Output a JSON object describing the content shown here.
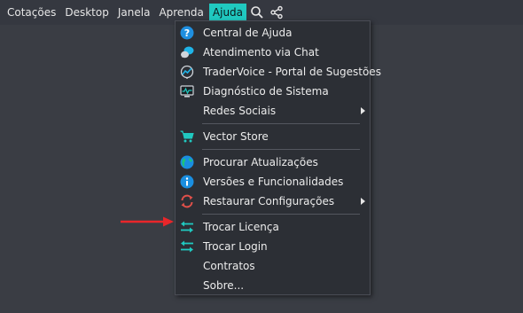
{
  "menubar": {
    "items": [
      {
        "label": "Cotações"
      },
      {
        "label": "Desktop"
      },
      {
        "label": "Janela"
      },
      {
        "label": "Aprenda"
      },
      {
        "label": "Ajuda"
      }
    ],
    "active": "Ajuda"
  },
  "help_menu": {
    "items": [
      {
        "label": "Central de Ajuda",
        "icon": "help-icon"
      },
      {
        "label": "Atendimento via Chat",
        "icon": "chat-icon"
      },
      {
        "label": "TraderVoice - Portal de Sugestões",
        "icon": "tradervoice-icon"
      },
      {
        "label": "Diagnóstico de Sistema",
        "icon": "monitor-icon"
      },
      {
        "label": "Redes Sociais",
        "icon": "",
        "submenu": true
      },
      {
        "label": "Vector Store",
        "icon": "cart-icon"
      },
      {
        "label": "Procurar Atualizações",
        "icon": "globe-icon"
      },
      {
        "label": "Versões e Funcionalidades",
        "icon": "info-icon"
      },
      {
        "label": "Restaurar Configurações",
        "icon": "restore-icon",
        "submenu": true
      },
      {
        "label": "Trocar Licença",
        "icon": "swap-arrows-icon"
      },
      {
        "label": "Trocar Login",
        "icon": "swap-arrows-icon"
      },
      {
        "label": "Contratos",
        "icon": ""
      },
      {
        "label": "Sobre...",
        "icon": ""
      }
    ]
  },
  "colors": {
    "accent": "#20c9c0",
    "background": "#3a3d44",
    "menu_background": "#2c2f35",
    "annotation_arrow": "#e8262a"
  }
}
